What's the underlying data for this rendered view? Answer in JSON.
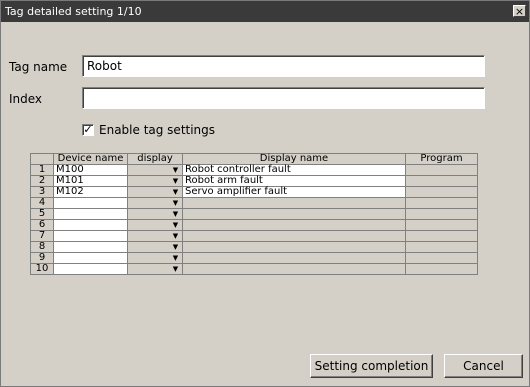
{
  "window": {
    "title": "Tag detailed setting  1/10",
    "close_glyph": "×"
  },
  "form": {
    "tag_name_label": "Tag name",
    "tag_name_value": "Robot",
    "index_label": "Index",
    "index_value": "",
    "enable_label": "Enable tag settings",
    "enable_checked": true,
    "check_glyph": "✓"
  },
  "table": {
    "headers": [
      "",
      "Device name",
      "display",
      "Display name",
      "Program"
    ],
    "rows": [
      {
        "num": "1",
        "device": "M100",
        "display": "",
        "name": "Robot controller fault",
        "program": ""
      },
      {
        "num": "2",
        "device": "M101",
        "display": "",
        "name": "Robot arm fault",
        "program": ""
      },
      {
        "num": "3",
        "device": "M102",
        "display": "",
        "name": "Servo amplifier fault",
        "program": ""
      },
      {
        "num": "4",
        "device": "",
        "display": "",
        "name": "",
        "program": ""
      },
      {
        "num": "5",
        "device": "",
        "display": "",
        "name": "",
        "program": ""
      },
      {
        "num": "6",
        "device": "",
        "display": "",
        "name": "",
        "program": ""
      },
      {
        "num": "7",
        "device": "",
        "display": "",
        "name": "",
        "program": ""
      },
      {
        "num": "8",
        "device": "",
        "display": "",
        "name": "",
        "program": ""
      },
      {
        "num": "9",
        "device": "",
        "display": "",
        "name": "",
        "program": ""
      },
      {
        "num": "10",
        "device": "",
        "display": "",
        "name": "",
        "program": ""
      }
    ]
  },
  "buttons": {
    "complete": "Setting completion",
    "cancel": "Cancel"
  },
  "icons": {
    "dropdown": "chevron-down-icon",
    "close": "close-icon",
    "check": "check-icon"
  }
}
